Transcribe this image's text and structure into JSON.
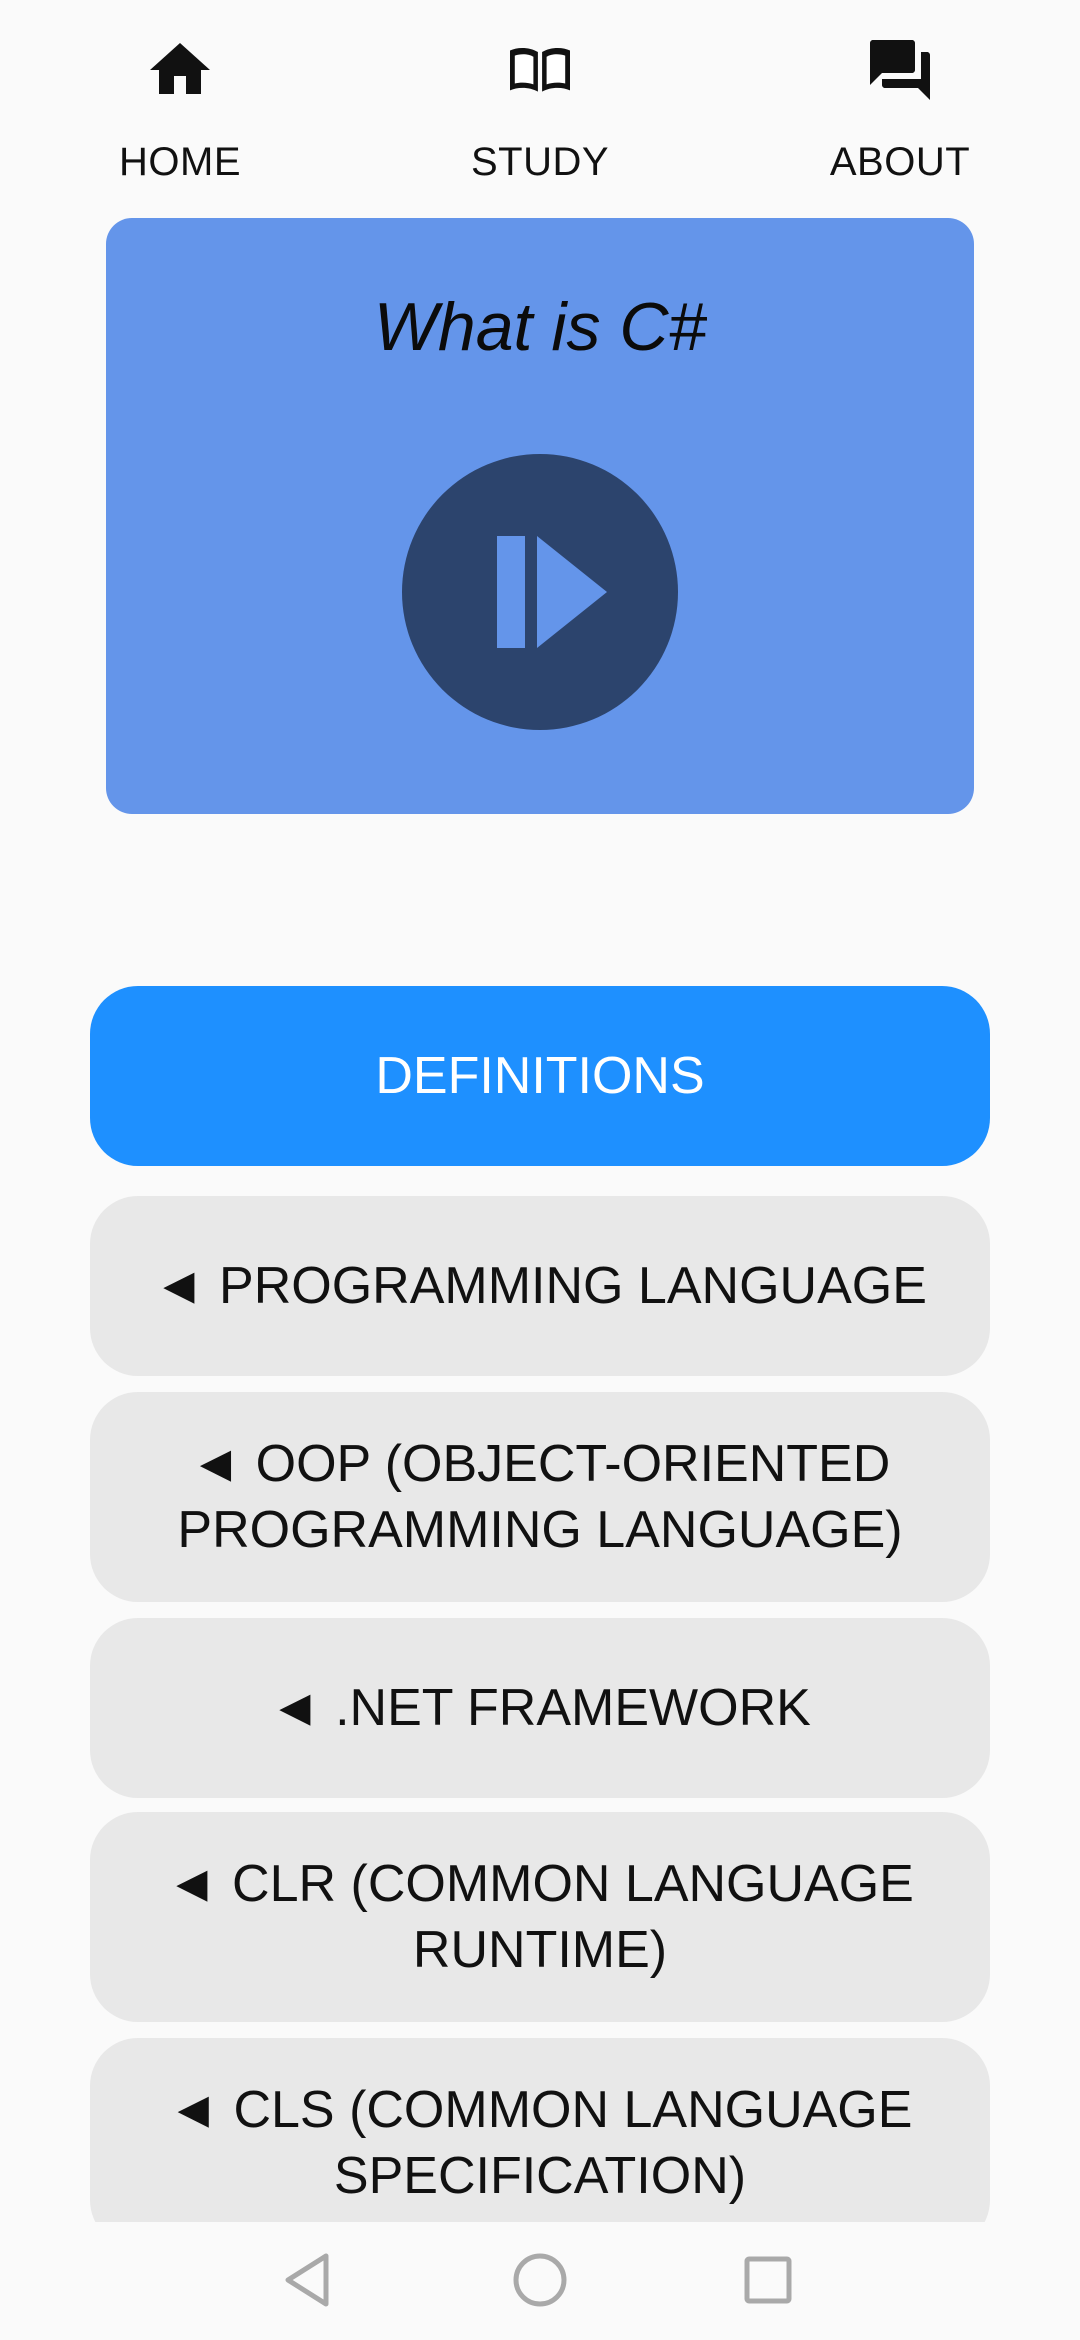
{
  "nav": {
    "items": [
      {
        "label": "HOME",
        "icon": "home-icon"
      },
      {
        "label": "STUDY",
        "icon": "book-icon"
      },
      {
        "label": "ABOUT",
        "icon": "forum-icon"
      }
    ]
  },
  "video": {
    "title": "What is C#",
    "play_icon": "play-icon"
  },
  "definitions": {
    "header": "DEFINITIONS",
    "items": [
      "◄ PROGRAMMING LANGUAGE",
      "◄ OOP (OBJECT-ORIENTED PROGRAMMING LANGUAGE)",
      "◄ .NET FRAMEWORK",
      "◄ CLR (COMMON LANGUAGE RUNTIME)",
      "◄ CLS (COMMON LANGUAGE SPECIFICATION)"
    ]
  },
  "system_nav": {
    "icons": [
      "back-icon",
      "home-circle-icon",
      "recents-icon"
    ]
  },
  "colors": {
    "background": "#fafafa",
    "video_card": "#6495ea",
    "play_button": "#2c446d",
    "primary_button": "#1e90ff",
    "definition_button": "#e8e8e8"
  }
}
